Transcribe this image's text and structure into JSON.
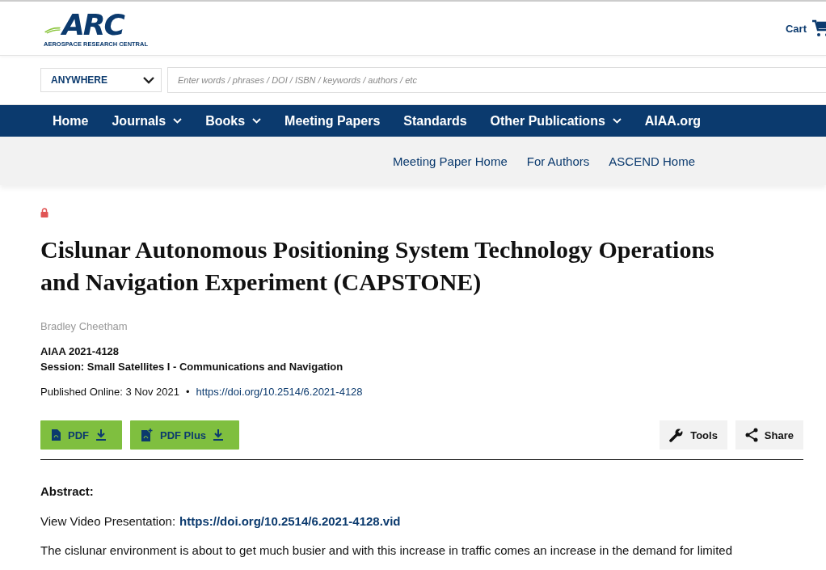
{
  "logo": {
    "mark": "ARC",
    "tagline": "AEROSPACE RESEARCH CENTRAL"
  },
  "cart": {
    "label": "Cart"
  },
  "search": {
    "scope": "ANYWHERE",
    "placeholder": "Enter words / phrases / DOI / ISBN / keywords / authors / etc"
  },
  "nav": [
    {
      "label": "Home",
      "has_menu": false
    },
    {
      "label": "Journals",
      "has_menu": true
    },
    {
      "label": "Books",
      "has_menu": true
    },
    {
      "label": "Meeting Papers",
      "has_menu": false
    },
    {
      "label": "Standards",
      "has_menu": false
    },
    {
      "label": "Other Publications",
      "has_menu": true
    },
    {
      "label": "AIAA.org",
      "has_menu": false
    }
  ],
  "subnav": [
    "Meeting Paper Home",
    "For Authors",
    "ASCEND Home"
  ],
  "article": {
    "locked": true,
    "title": "Cislunar Autonomous Positioning System Technology Operations and Navigation Experiment (CAPSTONE)",
    "author": "Bradley Cheetham",
    "paper_id": "AIAA 2021-4128",
    "session": "Session: Small Satellites I - Communications and Navigation",
    "published": "Published Online: 3 Nov 2021",
    "separator": "•",
    "doi": "https://doi.org/10.2514/6.2021-4128"
  },
  "downloads": [
    {
      "label": "PDF",
      "kind": "pdf"
    },
    {
      "label": "PDF Plus",
      "kind": "pdfplus"
    }
  ],
  "actions": [
    {
      "label": "Tools",
      "kind": "tools"
    },
    {
      "label": "Share",
      "kind": "share"
    }
  ],
  "abstract": {
    "heading": "Abstract:",
    "video_label": "View Video Presentation:",
    "video_link": "https://doi.org/10.2514/6.2021-4128.vid",
    "text": "The cislunar environment is about to get much busier and with this increase in traffic comes an increase in the demand for limited"
  }
}
